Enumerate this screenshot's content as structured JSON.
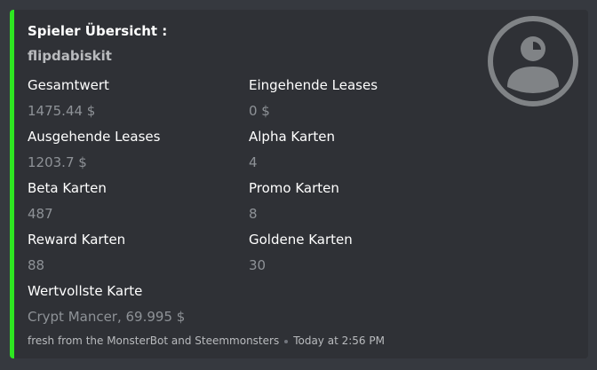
{
  "embed": {
    "accent_color": "#2ee621",
    "title": "Spieler Übersicht :",
    "subtitle": "flipdabiskit",
    "thumbnail_icon": "user-avatar-icon",
    "fields": [
      {
        "name": "Gesamtwert",
        "value": "1475.44 $"
      },
      {
        "name": "Eingehende Leases",
        "value": "0 $"
      },
      {
        "name": "Ausgehende Leases",
        "value": "1203.7 $"
      },
      {
        "name": "Alpha Karten",
        "value": "4"
      },
      {
        "name": "Beta Karten",
        "value": "487"
      },
      {
        "name": "Promo Karten",
        "value": "8"
      },
      {
        "name": "Reward Karten",
        "value": "88"
      },
      {
        "name": "Goldene Karten",
        "value": "30"
      },
      {
        "name": "Wertvollste Karte",
        "value": "Crypt Mancer, 69.995 $"
      }
    ],
    "footer": {
      "text": "fresh from the MonsterBot and Steemmonsters",
      "timestamp": "Today at 2:56 PM"
    }
  }
}
